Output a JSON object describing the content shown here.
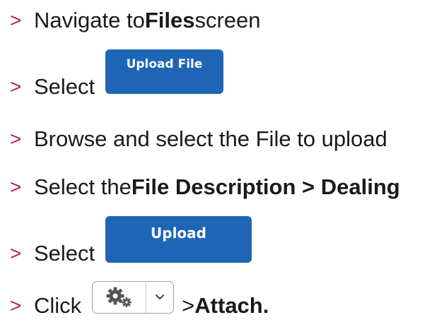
{
  "steps": [
    {
      "bullet": ">",
      "text": "Navigate to ",
      "bold": "Files",
      "tail": " screen"
    },
    {
      "bullet": ">",
      "text": "Select",
      "button_label": "Upload File"
    },
    {
      "bullet": ">",
      "text": "Browse and select the File to upload"
    },
    {
      "bullet": ">",
      "text": "Select the ",
      "bold": "File Description > Dealing"
    },
    {
      "bullet": ">",
      "text": "Select",
      "button_label": "Upload"
    },
    {
      "bullet": ">",
      "text": "Click",
      "mid": " > ",
      "bold": "Attach."
    }
  ],
  "icons": {
    "gear": "gears-icon",
    "dropdown": "chevron-down-icon"
  },
  "colors": {
    "bullet": "#b21e6a",
    "button_bg": "#1e66b5",
    "button_text": "#ffffff"
  }
}
